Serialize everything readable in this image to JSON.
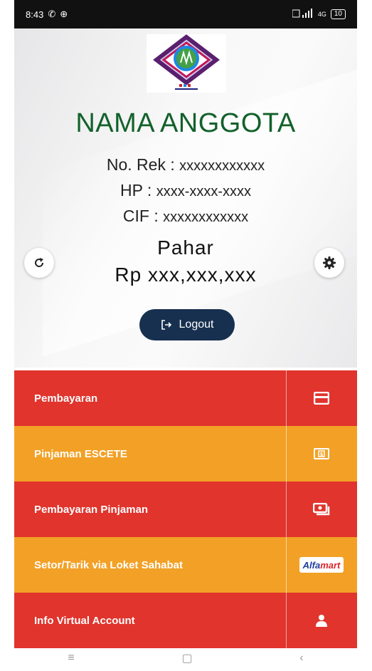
{
  "status_bar": {
    "time": "8:43",
    "left_icons": [
      "✆",
      "⊕"
    ],
    "signal_label": "4G",
    "battery": "10"
  },
  "profile": {
    "name": "NAMA ANGGOTA",
    "account_label": "No. Rek : ",
    "account_value": "xxxxxxxxxxxx",
    "phone_label": "HP : ",
    "phone_value": "xxxx-xxxx-xxxx",
    "cif_label": "CIF : ",
    "cif_value": "xxxxxxxxxxxx"
  },
  "balance": {
    "product": "Pahar",
    "amount": "Rp xxx,xxx,xxx"
  },
  "buttons": {
    "refresh_icon": "refresh-icon",
    "settings_icon": "gear-icon",
    "logout_label": "Logout"
  },
  "menu": [
    {
      "label": "Pembayaran",
      "icon": "credit-card-icon",
      "color": "#e0342d"
    },
    {
      "label": "Pinjaman ESCETE",
      "icon": "money-bill-icon",
      "color": "#f2a126"
    },
    {
      "label": "Pembayaran Pinjaman",
      "icon": "money-bills-icon",
      "color": "#e0342d"
    },
    {
      "label": "Setor/Tarik via Loket Sahabat",
      "icon": "alfamart-logo",
      "color": "#f2a126",
      "logo_text_1": "Alfa",
      "logo_text_2": "mart"
    },
    {
      "label": "Info Virtual Account",
      "icon": "user-icon",
      "color": "#e0342d"
    }
  ],
  "navbar": {
    "menu": "≡",
    "home": "▢",
    "back": "‹"
  }
}
